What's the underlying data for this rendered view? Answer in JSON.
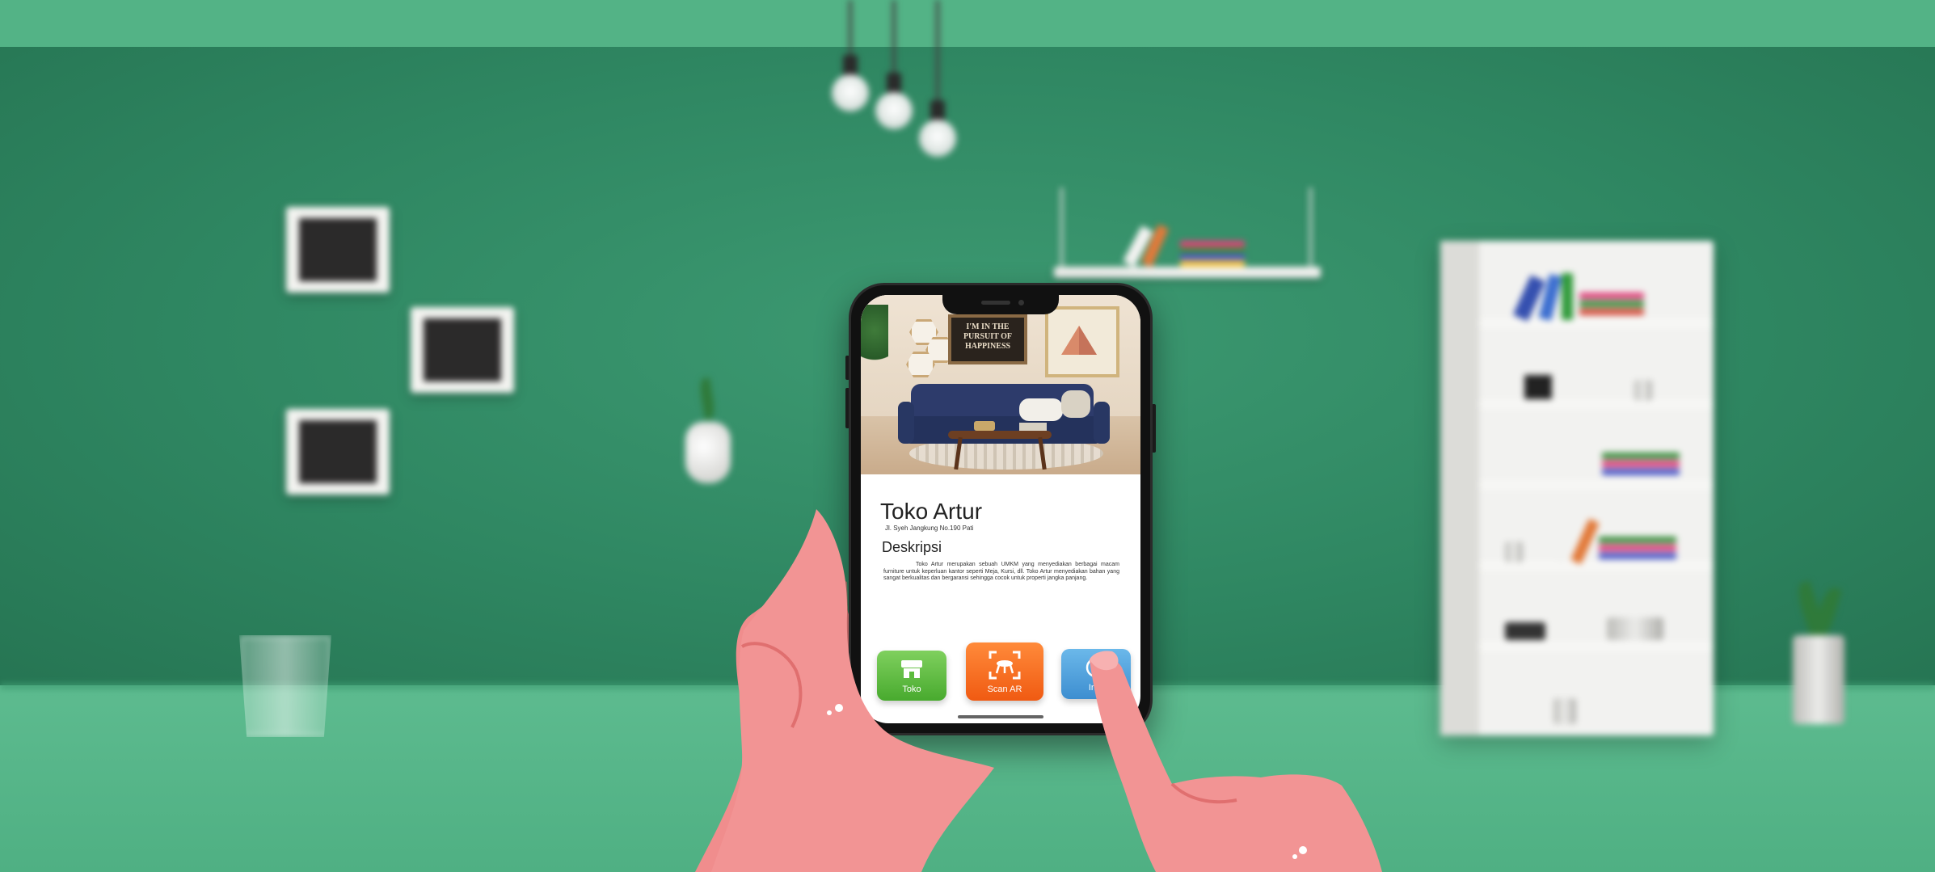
{
  "scene": {
    "poster_text": [
      "I'M IN THE",
      "PURSUIT OF",
      "HAPPINESS"
    ]
  },
  "app": {
    "store_name": "Toko Artur",
    "address": "Jl. Syeh Jangkung No.190 Pati",
    "description_heading": "Deskripsi",
    "description_text": "Toko Artur merupakan sebuah UMKM yang menyediakan berbagai macam furniture untuk keperluan kantor seperti Meja, Kursi, dll. Toko Artur menyediakan bahan yang sangat berkualitas dan bergaransi sehingga cocok untuk properti jangka panjang.",
    "menu": {
      "toko_label": "Toko",
      "scan_label": "Scan AR",
      "info_label": "Info"
    }
  },
  "colors": {
    "wall": "#2f8762",
    "floor": "#5dbb8f",
    "toko_button": "#5cbb3c",
    "scan_button": "#f56a1e",
    "info_button": "#4b9ddd"
  },
  "icons": {
    "toko": "store-icon",
    "scan": "ar-scan-icon",
    "info": "info-icon"
  }
}
